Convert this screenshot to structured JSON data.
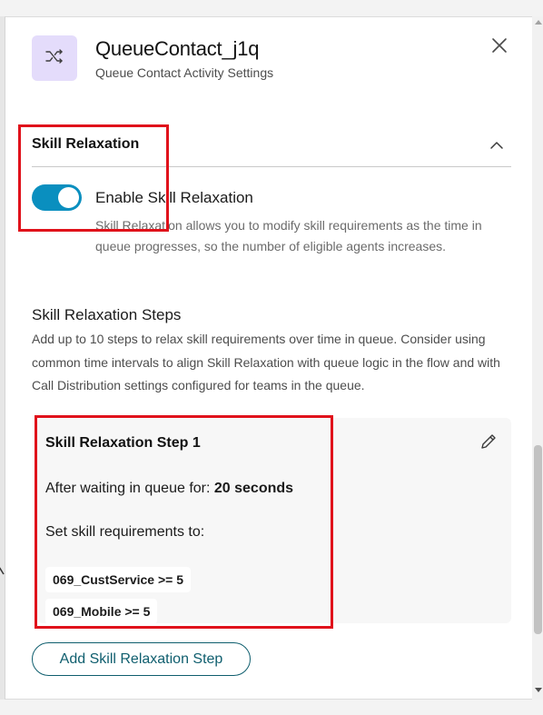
{
  "header": {
    "title": "QueueContact_j1q",
    "subtitle": "Queue Contact Activity Settings",
    "icon": "shuffle-icon",
    "close_icon": "close-icon"
  },
  "skill_relaxation": {
    "section_title": "Skill Relaxation",
    "collapse_icon": "chevron-up-icon",
    "toggle": {
      "label": "Enable Skill Relaxation",
      "checked": true,
      "help_text": "Skill Relaxation allows you to modify skill requirements as the time in queue progresses, so the number of eligible agents increases."
    },
    "steps_title": "Skill Relaxation Steps",
    "steps_description": "Add up to 10 steps to relax skill requirements over time in queue. Consider using common time intervals to align Skill Relaxation with queue logic in the flow and with Call Distribution settings configured for teams in the queue.",
    "steps": [
      {
        "title": "Skill Relaxation Step 1",
        "wait_label": "After waiting in queue for:",
        "wait_value": "20 seconds",
        "requirements_label": "Set skill requirements to:",
        "skills": [
          "069_CustService >= 5",
          "069_Mobile >= 5"
        ]
      }
    ],
    "add_step_label": "Add Skill Relaxation Step"
  },
  "colors": {
    "toggle_on": "#0a8fbf",
    "icon_tile": "#e4dcfb",
    "accent_button": "#0f5e6e",
    "annotation": "#e0121b"
  }
}
